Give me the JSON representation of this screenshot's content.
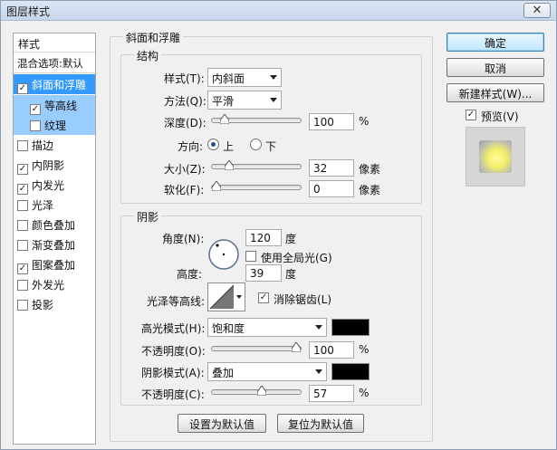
{
  "window": {
    "title": "图层样式",
    "close": "✕"
  },
  "sidebar": {
    "header": "样式",
    "blend": "混合选项:默认",
    "items": [
      {
        "label": "斜面和浮雕",
        "checked": true
      },
      {
        "label": "等高线",
        "checked": true
      },
      {
        "label": "纹理",
        "checked": false
      },
      {
        "label": "描边",
        "checked": false
      },
      {
        "label": "内阴影",
        "checked": true
      },
      {
        "label": "内发光",
        "checked": true
      },
      {
        "label": "光泽",
        "checked": false
      },
      {
        "label": "颜色叠加",
        "checked": false
      },
      {
        "label": "渐变叠加",
        "checked": false
      },
      {
        "label": "图案叠加",
        "checked": true
      },
      {
        "label": "外发光",
        "checked": false
      },
      {
        "label": "投影",
        "checked": false
      }
    ],
    "check_mark": "✓"
  },
  "bevel": {
    "section_title": "斜面和浮雕",
    "structure_title": "结构",
    "style_label": "样式(T):",
    "style_value": "内斜面",
    "method_label": "方法(Q):",
    "method_value": "平滑",
    "depth_label": "深度(D):",
    "depth_value": "100",
    "depth_unit": "%",
    "depth_level": 0.1,
    "direction_label": "方向:",
    "dir_up": "上",
    "dir_down": "下",
    "size_label": "大小(Z):",
    "size_value": "32",
    "size_unit": "像素",
    "size_level": 0.16,
    "soften_label": "软化(F):",
    "soften_value": "0",
    "soften_unit": "像素",
    "soften_level": 0.0
  },
  "shading": {
    "title": "阴影",
    "angle_label": "角度(N):",
    "angle_value": "120",
    "angle_unit": "度",
    "global_light": "使用全局光(G)",
    "altitude_label": "高度:",
    "altitude_value": "39",
    "altitude_unit": "度",
    "gloss_label": "光泽等高线:",
    "antialias": "消除锯齿(L)",
    "highlight_mode_label": "高光模式(H):",
    "highlight_mode_value": "饱和度",
    "highlight_color": "#000000",
    "highlight_opacity_label": "不透明度(O):",
    "highlight_opacity_value": "100",
    "highlight_opacity_unit": "%",
    "highlight_level": 1.0,
    "shadow_mode_label": "阴影模式(A):",
    "shadow_mode_value": "叠加",
    "shadow_color": "#000000",
    "shadow_opacity_label": "不透明度(C):",
    "shadow_opacity_value": "57",
    "shadow_opacity_unit": "%",
    "shadow_level": 0.57
  },
  "footer": {
    "set_default": "设置为默认值",
    "reset_default": "复位为默认值"
  },
  "actions": {
    "ok": "确定",
    "cancel": "取消",
    "new_style": "新建样式(W)...",
    "preview": "预览(V)"
  }
}
